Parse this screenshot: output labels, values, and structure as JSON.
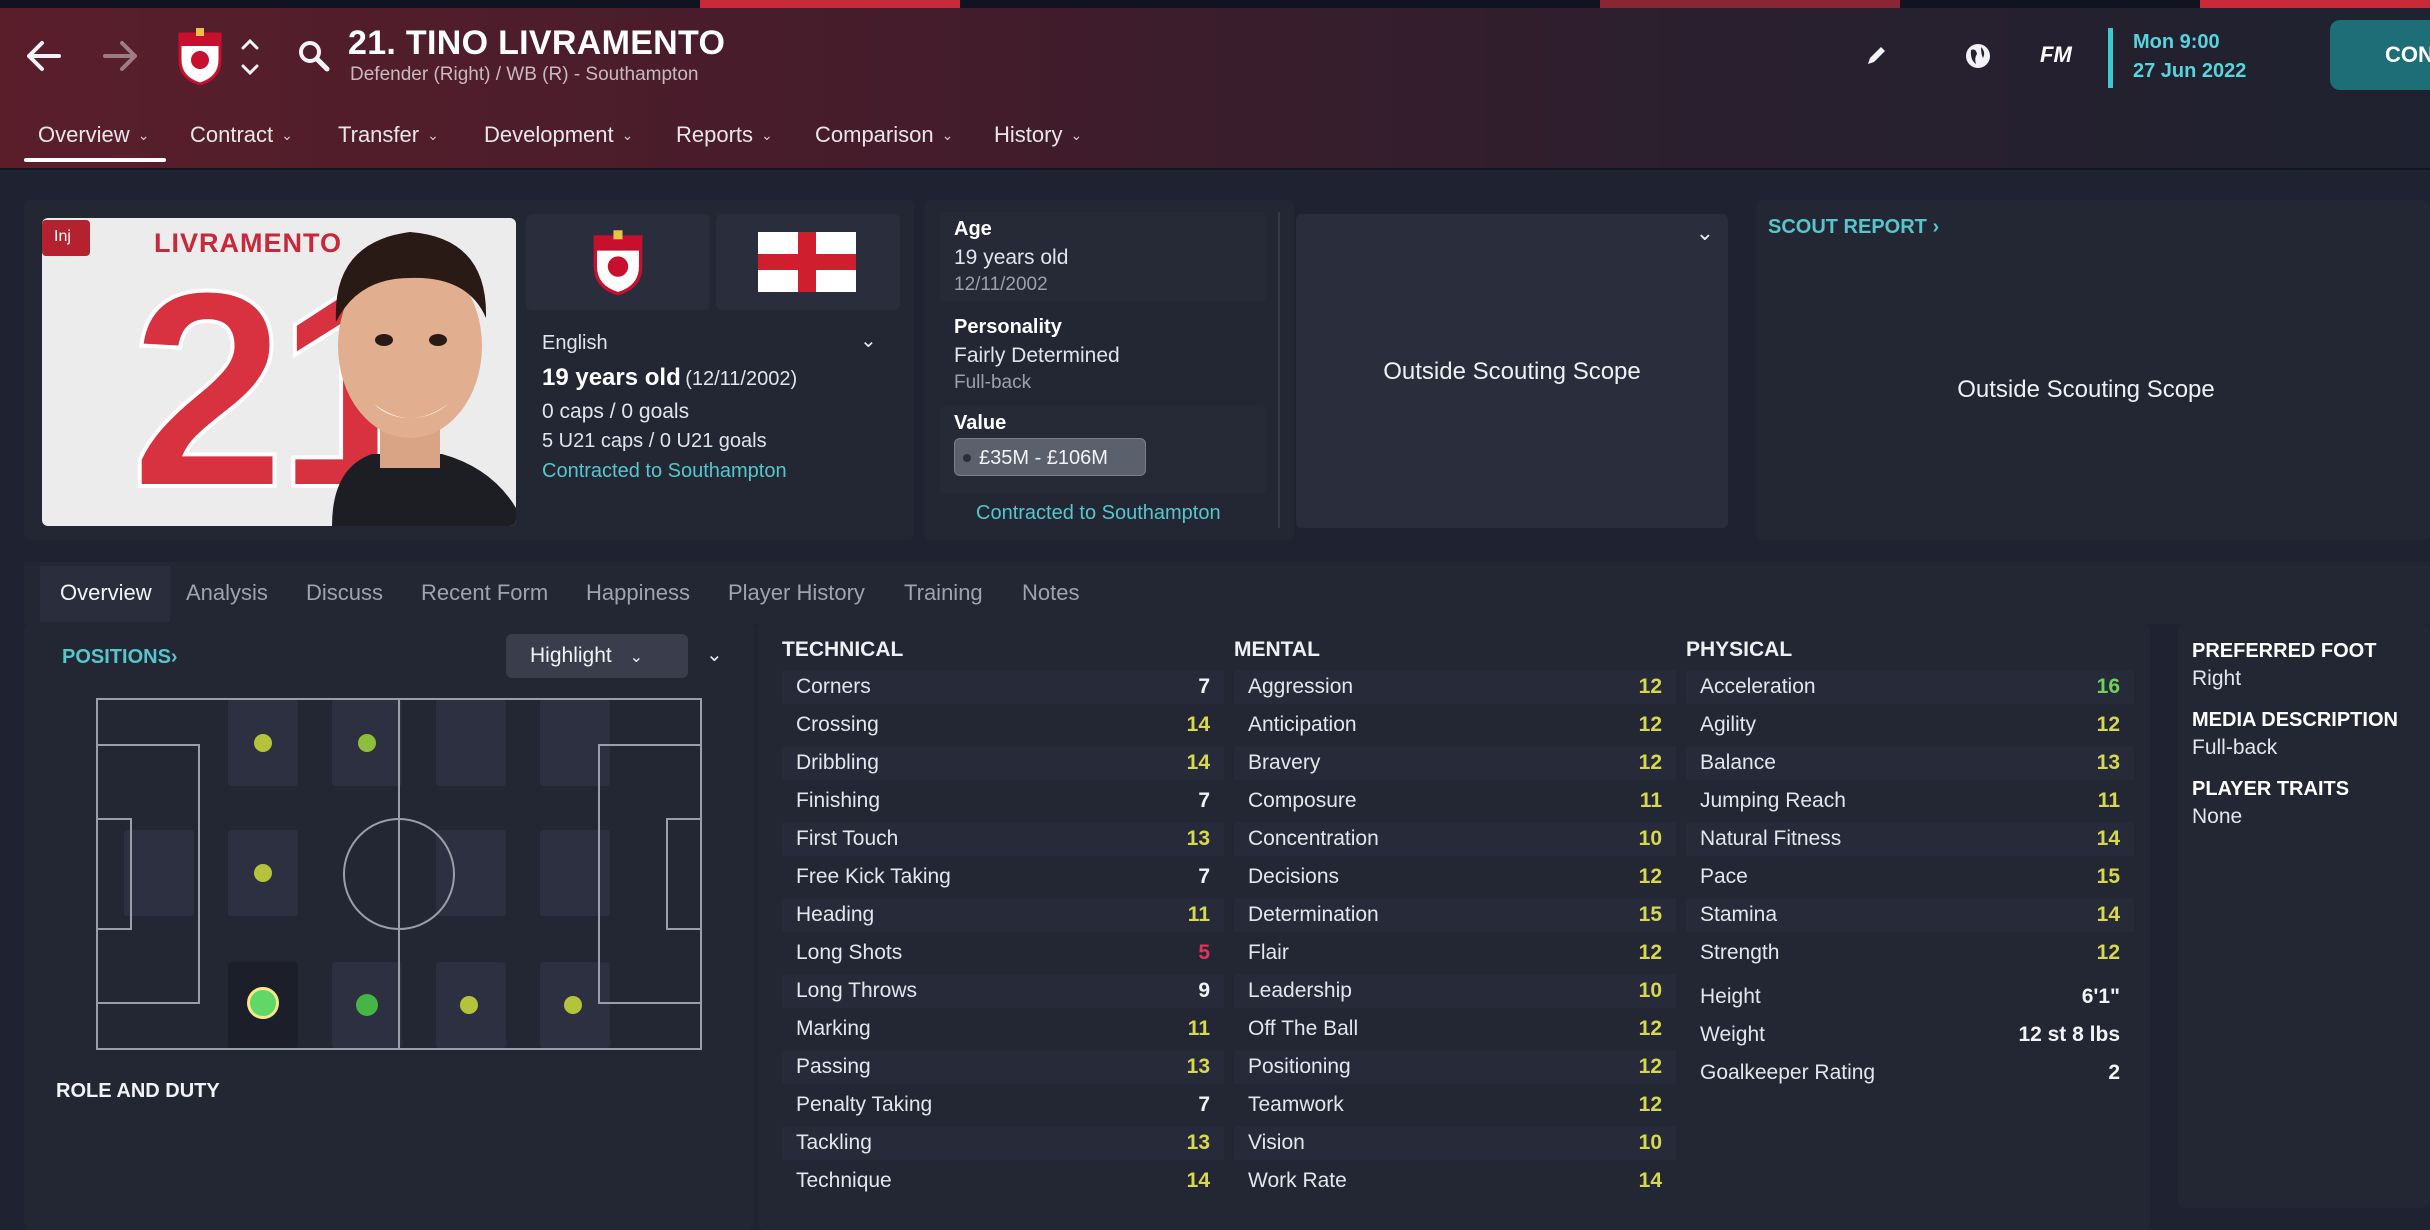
{
  "header": {
    "title": "21. TINO LIVRAMENTO",
    "subtitle": "Defender (Right) / WB (R) - Southampton",
    "date_line1": "Mon 9:00",
    "date_line2": "27 Jun 2022",
    "continue_label": "CON",
    "fm_label": "FM",
    "nav_tabs": [
      "Overview",
      "Contract",
      "Transfer",
      "Development",
      "Reports",
      "Comparison",
      "History"
    ]
  },
  "profile": {
    "injury_badge": "Inj",
    "shirt_name": "LIVRAMENTO",
    "shirt_number": "21",
    "nationality": "English",
    "age_text": "19 years old",
    "dob_paren": "(12/11/2002)",
    "caps": "0 caps / 0 goals",
    "u21_caps": "5 U21 caps / 0 U21 goals",
    "contract_status": "Contracted to Southampton"
  },
  "info_card": {
    "age_label": "Age",
    "age_value": "19 years old",
    "dob": "12/11/2002",
    "personality_label": "Personality",
    "personality_value": "Fairly Determined",
    "personality_sub": "Full-back",
    "value_label": "Value",
    "value_range": "£35M - £106M",
    "contract_link": "Contracted to Southampton"
  },
  "scouting": {
    "scope_text": "Outside Scouting Scope",
    "report_label": "SCOUT REPORT",
    "report_scope_text": "Outside Scouting Scope"
  },
  "subtabs": [
    "Overview",
    "Analysis",
    "Discuss",
    "Recent Form",
    "Happiness",
    "Player History",
    "Training",
    "Notes"
  ],
  "positions": {
    "label": "POSITIONS",
    "highlight_label": "Highlight",
    "role_duty_label": "ROLE AND DUTY"
  },
  "technical": {
    "heading": "TECHNICAL",
    "rows": [
      {
        "name": "Corners",
        "value": "7",
        "tone": "w"
      },
      {
        "name": "Crossing",
        "value": "14",
        "tone": "y"
      },
      {
        "name": "Dribbling",
        "value": "14",
        "tone": "y"
      },
      {
        "name": "Finishing",
        "value": "7",
        "tone": "w"
      },
      {
        "name": "First Touch",
        "value": "13",
        "tone": "y"
      },
      {
        "name": "Free Kick Taking",
        "value": "7",
        "tone": "w"
      },
      {
        "name": "Heading",
        "value": "11",
        "tone": "y"
      },
      {
        "name": "Long Shots",
        "value": "5",
        "tone": "r"
      },
      {
        "name": "Long Throws",
        "value": "9",
        "tone": "w"
      },
      {
        "name": "Marking",
        "value": "11",
        "tone": "y"
      },
      {
        "name": "Passing",
        "value": "13",
        "tone": "y"
      },
      {
        "name": "Penalty Taking",
        "value": "7",
        "tone": "w"
      },
      {
        "name": "Tackling",
        "value": "13",
        "tone": "y"
      },
      {
        "name": "Technique",
        "value": "14",
        "tone": "y"
      }
    ]
  },
  "mental": {
    "heading": "MENTAL",
    "rows": [
      {
        "name": "Aggression",
        "value": "12",
        "tone": "y"
      },
      {
        "name": "Anticipation",
        "value": "12",
        "tone": "y"
      },
      {
        "name": "Bravery",
        "value": "12",
        "tone": "y"
      },
      {
        "name": "Composure",
        "value": "11",
        "tone": "y"
      },
      {
        "name": "Concentration",
        "value": "10",
        "tone": "y"
      },
      {
        "name": "Decisions",
        "value": "12",
        "tone": "y"
      },
      {
        "name": "Determination",
        "value": "15",
        "tone": "y"
      },
      {
        "name": "Flair",
        "value": "12",
        "tone": "y"
      },
      {
        "name": "Leadership",
        "value": "10",
        "tone": "y"
      },
      {
        "name": "Off The Ball",
        "value": "12",
        "tone": "y"
      },
      {
        "name": "Positioning",
        "value": "12",
        "tone": "y"
      },
      {
        "name": "Teamwork",
        "value": "12",
        "tone": "y"
      },
      {
        "name": "Vision",
        "value": "10",
        "tone": "y"
      },
      {
        "name": "Work Rate",
        "value": "14",
        "tone": "y"
      }
    ]
  },
  "physical": {
    "heading": "PHYSICAL",
    "rows": [
      {
        "name": "Acceleration",
        "value": "16",
        "tone": "g"
      },
      {
        "name": "Agility",
        "value": "12",
        "tone": "y"
      },
      {
        "name": "Balance",
        "value": "13",
        "tone": "y"
      },
      {
        "name": "Jumping Reach",
        "value": "11",
        "tone": "y"
      },
      {
        "name": "Natural Fitness",
        "value": "14",
        "tone": "y"
      },
      {
        "name": "Pace",
        "value": "15",
        "tone": "y"
      },
      {
        "name": "Stamina",
        "value": "14",
        "tone": "y"
      },
      {
        "name": "Strength",
        "value": "12",
        "tone": "y"
      }
    ],
    "extras": [
      {
        "name": "Height",
        "value": "6'1\""
      },
      {
        "name": "Weight",
        "value": "12 st 8 lbs"
      },
      {
        "name": "Goalkeeper Rating",
        "value": "2"
      }
    ]
  },
  "side_info": {
    "foot_label": "PREFERRED FOOT",
    "foot_value": "Right",
    "media_label": "MEDIA DESCRIPTION",
    "media_value": "Full-back",
    "traits_label": "PLAYER TRAITS",
    "traits_value": "None"
  },
  "colors": {
    "accent": "#57d4dc",
    "highlight_yellow": "#d7d84c",
    "good_green": "#6fd25a",
    "bad_red": "#e0335a",
    "header_red": "#5a1e2b"
  }
}
